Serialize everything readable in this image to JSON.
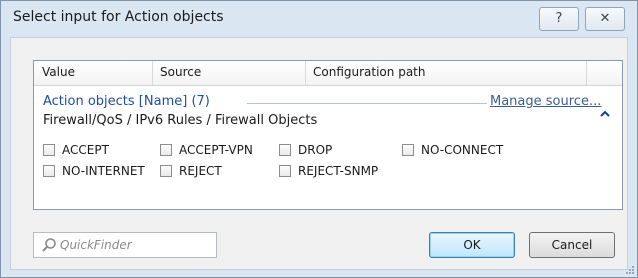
{
  "window": {
    "title": "Select input for Action objects"
  },
  "titlebar": {
    "help_label": "?",
    "close_label": "✕"
  },
  "columns": [
    "Value",
    "Source",
    "Configuration path"
  ],
  "group": {
    "title": "Action objects [Name] (7)",
    "manage_link": "Manage source...",
    "path": "Firewall/QoS / IPv6 Rules / Firewall Objects"
  },
  "options": [
    {
      "label": "ACCEPT",
      "checked": false
    },
    {
      "label": "ACCEPT-VPN",
      "checked": false
    },
    {
      "label": "DROP",
      "checked": false
    },
    {
      "label": "NO-CONNECT",
      "checked": false
    },
    {
      "label": "NO-INTERNET",
      "checked": false
    },
    {
      "label": "REJECT",
      "checked": false
    },
    {
      "label": "REJECT-SNMP",
      "checked": false
    }
  ],
  "search": {
    "placeholder": "QuickFinder"
  },
  "buttons": {
    "ok": "OK",
    "cancel": "Cancel"
  }
}
